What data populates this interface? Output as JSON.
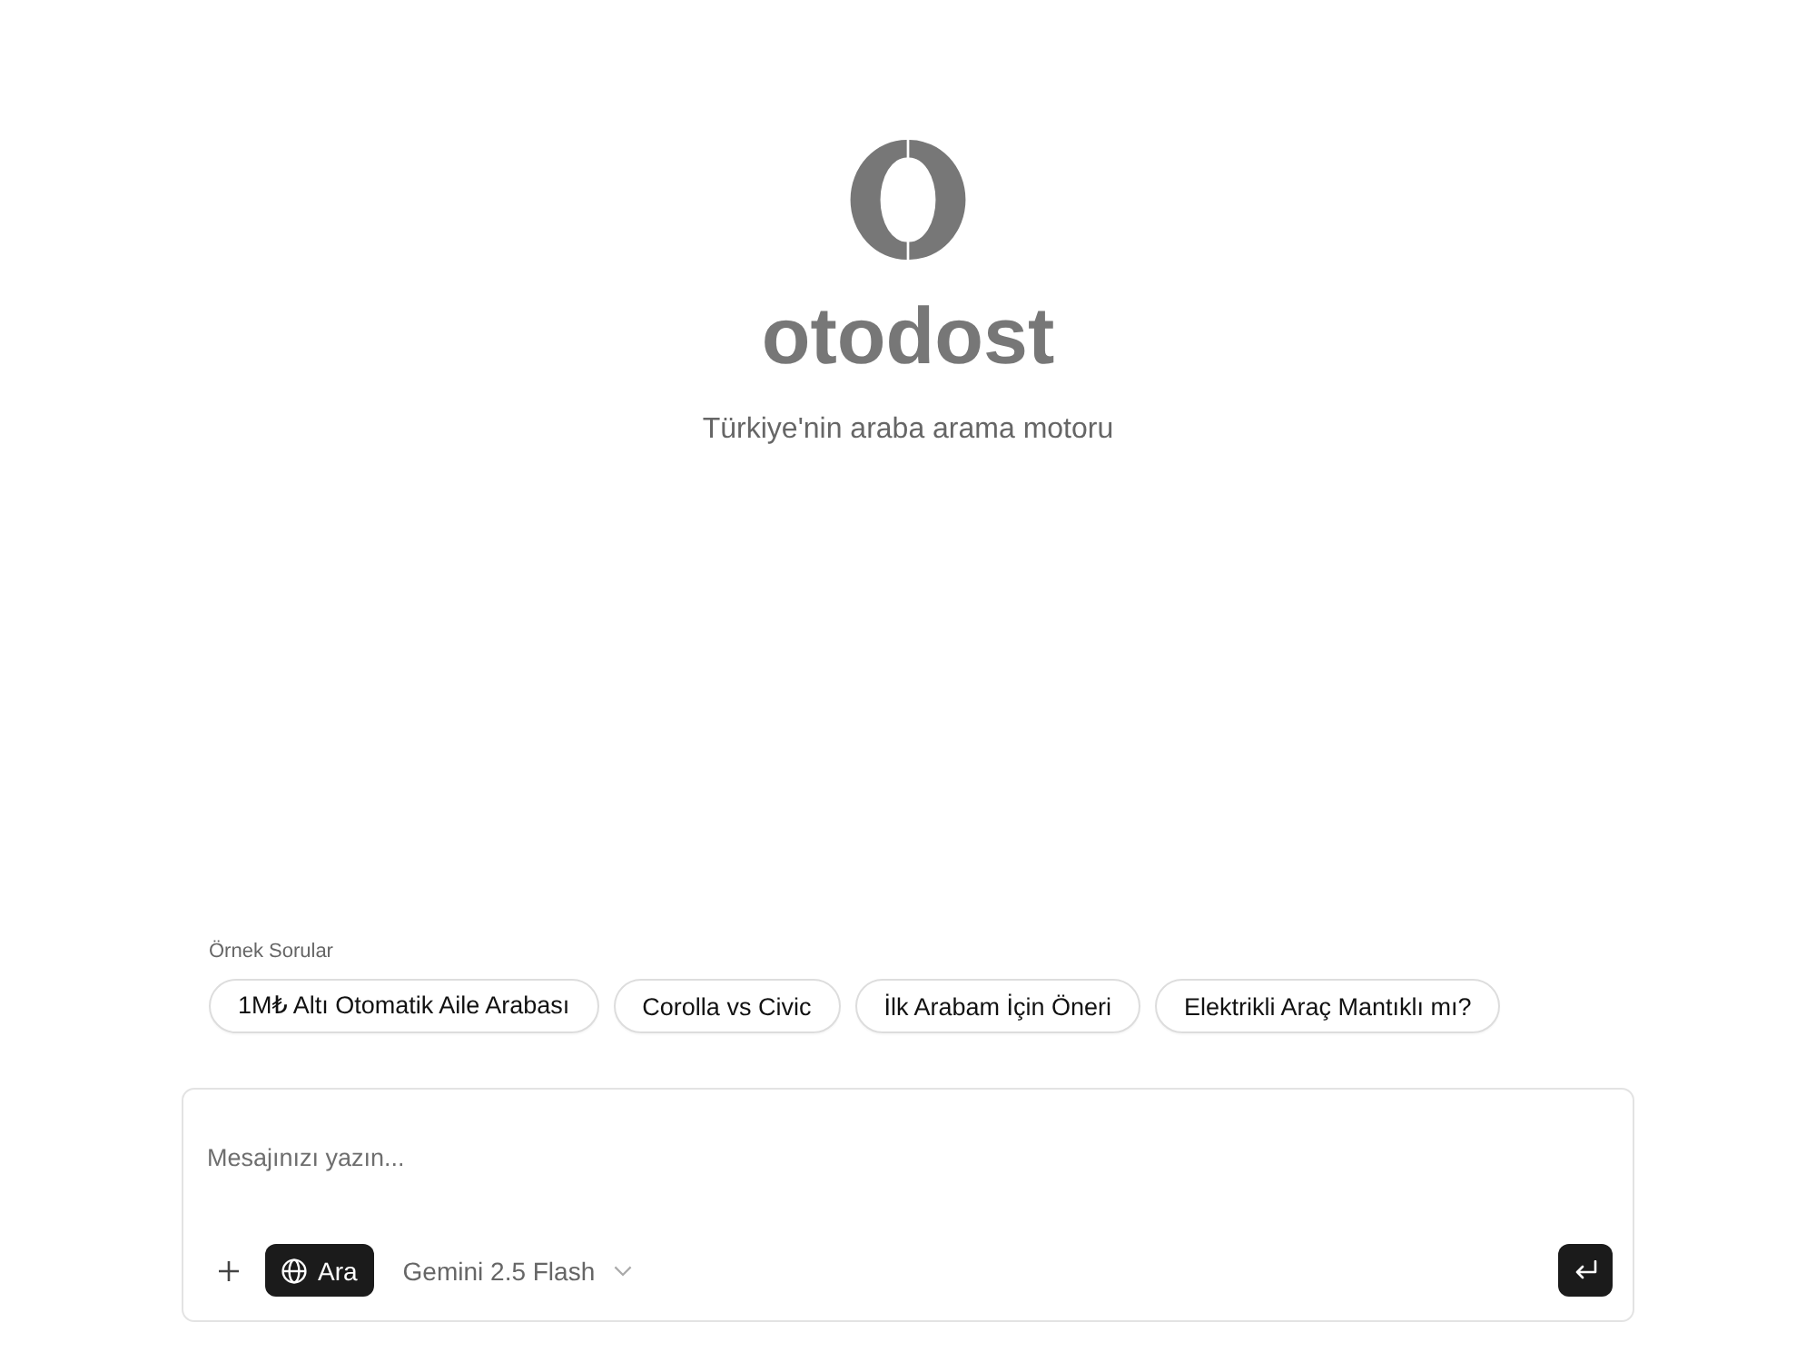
{
  "logo": {
    "wordmark": "otodost",
    "tagline": "Türkiye'nin araba arama motoru"
  },
  "examples": {
    "title": "Örnek Sorular",
    "chips": [
      "1M₺ Altı Otomatik Aile Arabası",
      "Corolla vs Civic",
      "İlk Arabam İçin Öneri",
      "Elektrikli Araç Mantıklı mı?"
    ]
  },
  "composer": {
    "placeholder": "Mesajınızı yazın...",
    "search_toggle": {
      "label": "Ara",
      "on": true
    },
    "model": "Gemini 2.5 Flash"
  }
}
